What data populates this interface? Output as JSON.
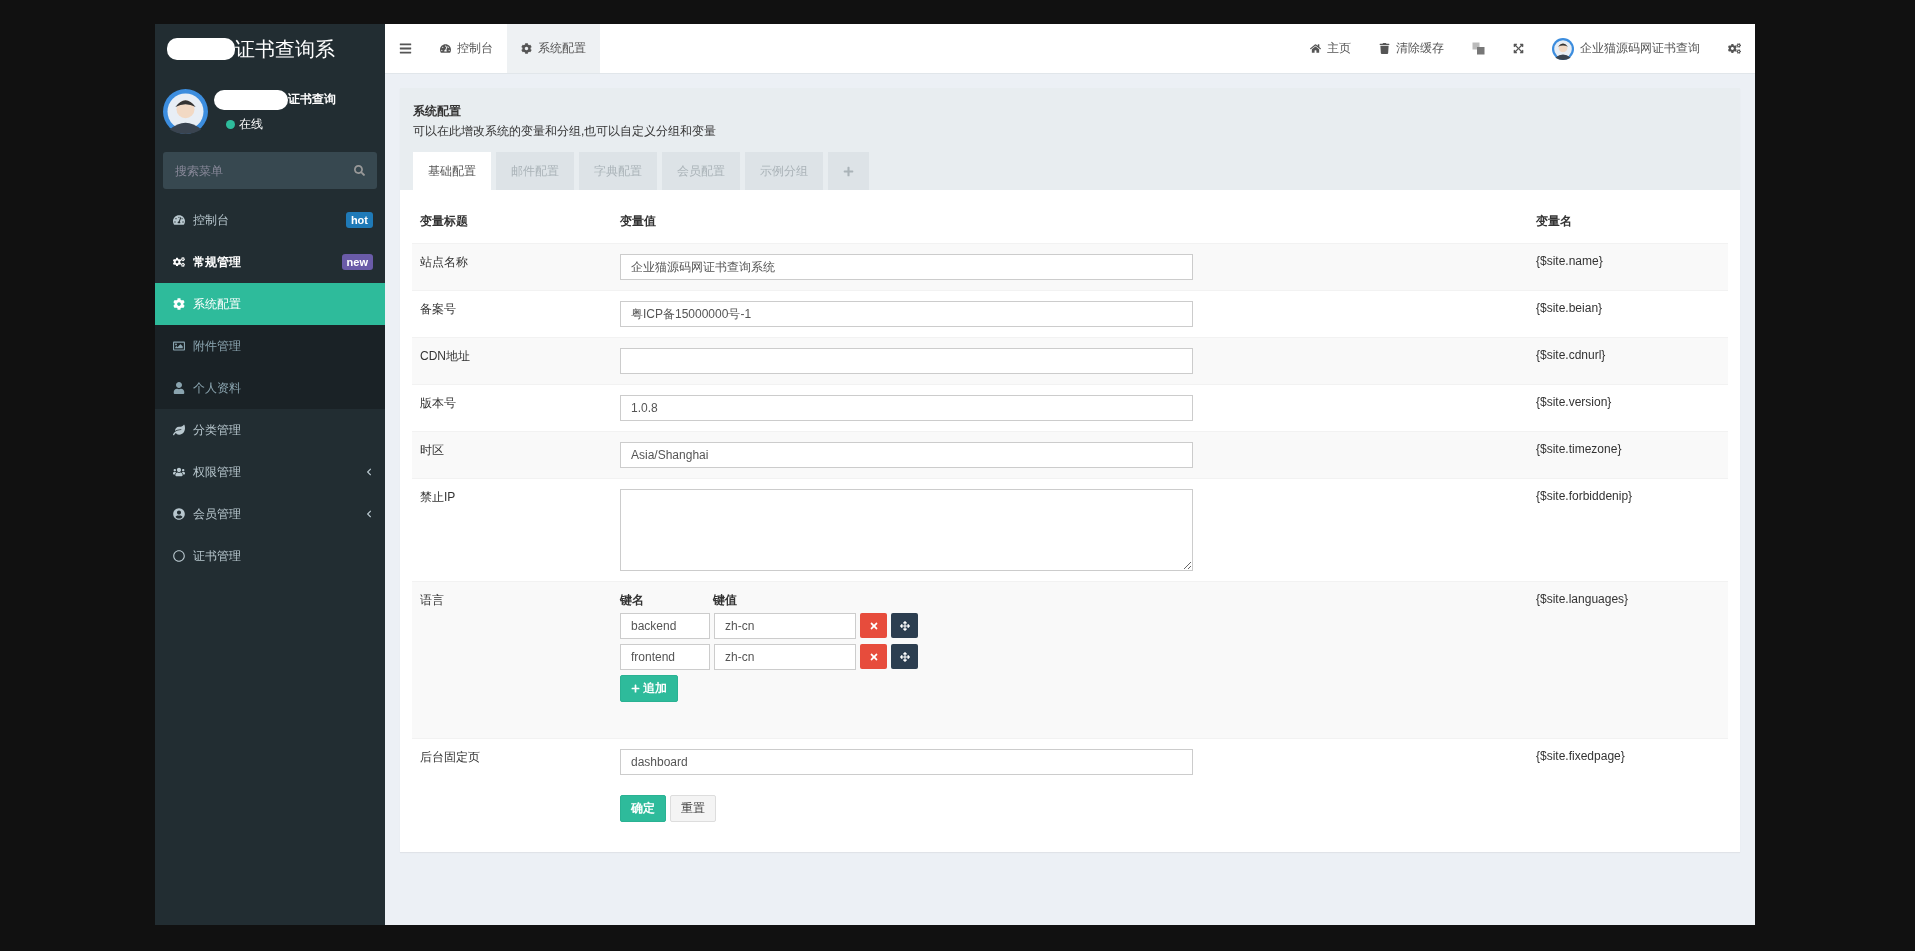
{
  "sidebar": {
    "logo_text": "证书查询系",
    "user": {
      "name": "证书查询",
      "status": "在线",
      "online": true
    },
    "search": {
      "placeholder": "搜索菜单"
    },
    "menu": [
      {
        "label": "控制台",
        "selected": false,
        "badge": {
          "text": "hot",
          "color": "#1f7ab8"
        }
      },
      {
        "label": "常规管理",
        "selected": false,
        "expanded": true,
        "badge": {
          "text": "new",
          "color": "#6a5ba8"
        },
        "children": [
          {
            "label": "系统配置",
            "selected": true
          },
          {
            "label": "附件管理",
            "selected": false
          },
          {
            "label": "个人资料",
            "selected": false
          }
        ]
      },
      {
        "label": "分类管理",
        "selected": false
      },
      {
        "label": "权限管理",
        "selected": false,
        "expanded": false
      },
      {
        "label": "会员管理",
        "selected": false,
        "expanded": false
      },
      {
        "label": "证书管理",
        "selected": false
      }
    ]
  },
  "header": {
    "tabs": [
      {
        "label": "控制台",
        "selected": false
      },
      {
        "label": "系统配置",
        "selected": true
      }
    ],
    "links": [
      "主页",
      "清除缓存"
    ],
    "user_name": "企业猫源码网证书查询"
  },
  "panel": {
    "title": "系统配置",
    "description": "可以在此增改系统的变量和分组,也可以自定义分组和变量",
    "tabs": [
      {
        "label": "基础配置",
        "selected": true
      },
      {
        "label": "邮件配置",
        "selected": false
      },
      {
        "label": "字典配置",
        "selected": false
      },
      {
        "label": "会员配置",
        "selected": false
      },
      {
        "label": "示例分组",
        "selected": false
      }
    ],
    "table": {
      "columns": [
        "变量标题",
        "变量值",
        "变量名"
      ],
      "rows": [
        {
          "kind": "input",
          "label": "站点名称",
          "value": "企业猫源码网证书查询系统",
          "variable": "{$site.name}"
        },
        {
          "kind": "input",
          "label": "备案号",
          "value": "粤ICP备15000000号-1",
          "variable": "{$site.beian}"
        },
        {
          "kind": "input",
          "label": "CDN地址",
          "variable": "{$site.cdnurl}"
        },
        {
          "kind": "input",
          "label": "版本号",
          "value": "1.0.8",
          "variable": "{$site.version}"
        },
        {
          "kind": "input",
          "label": "时区",
          "value": "Asia/Shanghai",
          "variable": "{$site.timezone}"
        },
        {
          "kind": "textarea",
          "label": "禁止IP",
          "variable": "{$site.forbiddenip}"
        },
        {
          "kind": "array",
          "label": "语言",
          "variable": "{$site.languages}",
          "key_header": "键名",
          "value_header": "键值",
          "pairs": [
            {
              "key": "backend",
              "value": "zh-cn"
            },
            {
              "key": "frontend",
              "value": "zh-cn"
            }
          ],
          "add_button": "追加"
        },
        {
          "kind": "input",
          "label": "后台固定页",
          "value": "dashboard",
          "variable": "{$site.fixedpage}"
        }
      ]
    },
    "buttons": {
      "submit": "确定",
      "reset": "重置"
    }
  }
}
